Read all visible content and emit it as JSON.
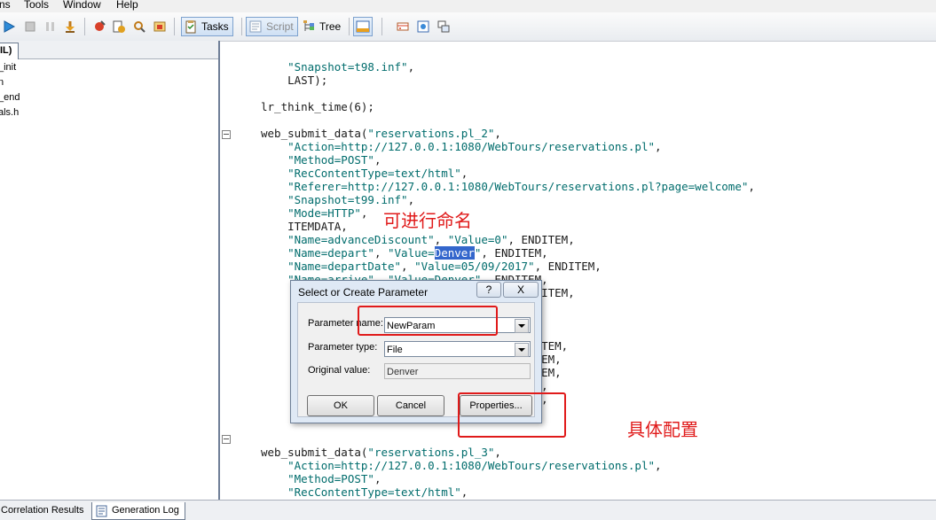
{
  "menu": {
    "items": [
      {
        "label": "ns"
      },
      {
        "label": "Tools"
      },
      {
        "label": "Window"
      },
      {
        "label": "Help"
      }
    ]
  },
  "toolbar": {
    "tasks_label": "Tasks",
    "script_label": "Script",
    "tree_label": "Tree"
  },
  "left_pane": {
    "tab_label": "IL)",
    "items": [
      "_init",
      "n",
      "_end",
      "als.h"
    ]
  },
  "editor": {
    "lines": [
      [
        {
          "t": "    \"Snapshot=t98.inf\"",
          "c": "str"
        },
        {
          "t": ",",
          "c": "plain"
        }
      ],
      [
        {
          "t": "    LAST);",
          "c": "plain"
        }
      ],
      [
        {
          "t": "",
          "c": "plain"
        }
      ],
      [
        {
          "t": "lr_think_time(6);",
          "c": "plain"
        }
      ],
      [
        {
          "t": "",
          "c": "plain"
        }
      ],
      [
        {
          "t": "web_submit_data(",
          "c": "plain"
        },
        {
          "t": "\"reservations.pl_2\"",
          "c": "str"
        },
        {
          "t": ",",
          "c": "plain"
        }
      ],
      [
        {
          "t": "    \"Action=http://127.0.0.1:1080/WebTours/reservations.pl\"",
          "c": "str"
        },
        {
          "t": ",",
          "c": "plain"
        }
      ],
      [
        {
          "t": "    \"Method=POST\"",
          "c": "str"
        },
        {
          "t": ",",
          "c": "plain"
        }
      ],
      [
        {
          "t": "    \"RecContentType=text/html\"",
          "c": "str"
        },
        {
          "t": ",",
          "c": "plain"
        }
      ],
      [
        {
          "t": "    \"Referer=http://127.0.0.1:1080/WebTours/reservations.pl?page=welcome\"",
          "c": "str"
        },
        {
          "t": ",",
          "c": "plain"
        }
      ],
      [
        {
          "t": "    \"Snapshot=t99.inf\"",
          "c": "str"
        },
        {
          "t": ",",
          "c": "plain"
        }
      ],
      [
        {
          "t": "    \"Mode=HTTP\"",
          "c": "str"
        },
        {
          "t": ",",
          "c": "plain"
        }
      ],
      [
        {
          "t": "    ITEMDATA,",
          "c": "plain"
        }
      ],
      [
        {
          "t": "    \"Name=advanceDiscount\"",
          "c": "str"
        },
        {
          "t": ", ",
          "c": "plain"
        },
        {
          "t": "\"Value=0\"",
          "c": "str"
        },
        {
          "t": ", ENDITEM,",
          "c": "plain"
        }
      ],
      [
        {
          "t": "    \"Name=depart\"",
          "c": "str"
        },
        {
          "t": ", ",
          "c": "plain"
        },
        {
          "t": "\"Value=",
          "c": "str"
        },
        {
          "t": "Denver",
          "c": "sel"
        },
        {
          "t": "\"",
          "c": "str"
        },
        {
          "t": ", ENDITEM,",
          "c": "plain"
        }
      ],
      [
        {
          "t": "    \"Name=departDate\"",
          "c": "str"
        },
        {
          "t": ", ",
          "c": "plain"
        },
        {
          "t": "\"Value=05/09/2017\"",
          "c": "str"
        },
        {
          "t": ", ENDITEM,",
          "c": "plain"
        }
      ],
      [
        {
          "t": "    \"Name=arrive\"",
          "c": "str"
        },
        {
          "t": ", ",
          "c": "plain"
        },
        {
          "t": "\"Value=Denver\"",
          "c": "str"
        },
        {
          "t": ", ENDITEM,",
          "c": "plain"
        }
      ],
      [
        {
          "t": "                                       ENDITEM,",
          "c": "plain"
        }
      ],
      [
        {
          "t": "                                   ITEM,",
          "c": "plain"
        }
      ],
      [
        {
          "t": "                                   ITEM,",
          "c": "plain"
        }
      ],
      [
        {
          "t": "                                   ITEM,",
          "c": "plain"
        }
      ],
      [
        {
          "t": "                                      ENDITEM,",
          "c": "plain"
        }
      ],
      [
        {
          "t": "                                     ENDITEM,",
          "c": "plain"
        }
      ],
      [
        {
          "t": "                                     ENDITEM,",
          "c": "plain"
        }
      ],
      [
        {
          "t": "                                    NDITEM,",
          "c": "plain"
        }
      ],
      [
        {
          "t": "                                    NDITEM,",
          "c": "plain"
        }
      ],
      [
        {
          "t": "",
          "c": "plain"
        }
      ],
      [
        {
          "t": "",
          "c": "plain"
        }
      ],
      [
        {
          "t": "",
          "c": "plain"
        }
      ],
      [
        {
          "t": "web_submit_data(",
          "c": "plain"
        },
        {
          "t": "\"reservations.pl_3\"",
          "c": "str"
        },
        {
          "t": ",",
          "c": "plain"
        }
      ],
      [
        {
          "t": "    \"Action=http://127.0.0.1:1080/WebTours/reservations.pl\"",
          "c": "str"
        },
        {
          "t": ",",
          "c": "plain"
        }
      ],
      [
        {
          "t": "    \"Method=POST\"",
          "c": "str"
        },
        {
          "t": ",",
          "c": "plain"
        }
      ],
      [
        {
          "t": "    \"RecContentType=text/html\"",
          "c": "str"
        },
        {
          "t": ",",
          "c": "plain"
        }
      ],
      [
        {
          "t": "    \"Referer=http://127.0.0.1:1080/WebTours/reservations.pl\"",
          "c": "str"
        },
        {
          "t": ",",
          "c": "plain"
        }
      ]
    ]
  },
  "annotations": {
    "rename_note": "可进行命名",
    "config_note": "具体配置"
  },
  "dialog": {
    "title": "Select or Create Parameter",
    "help_label": "?",
    "close_label": "X",
    "param_name_label": "Parameter name:",
    "param_name_value": "NewParam",
    "param_type_label": "Parameter type:",
    "param_type_value": "File",
    "original_value_label": "Original value:",
    "original_value": "Denver",
    "ok_label": "OK",
    "cancel_label": "Cancel",
    "properties_label": "Properties..."
  },
  "bottom_tabs": {
    "correlation_label": "Correlation Results",
    "generation_log_label": "Generation Log"
  },
  "colors": {
    "string": "#006c6c",
    "selection": "#3366cc",
    "annotation": "#e01a1a"
  }
}
